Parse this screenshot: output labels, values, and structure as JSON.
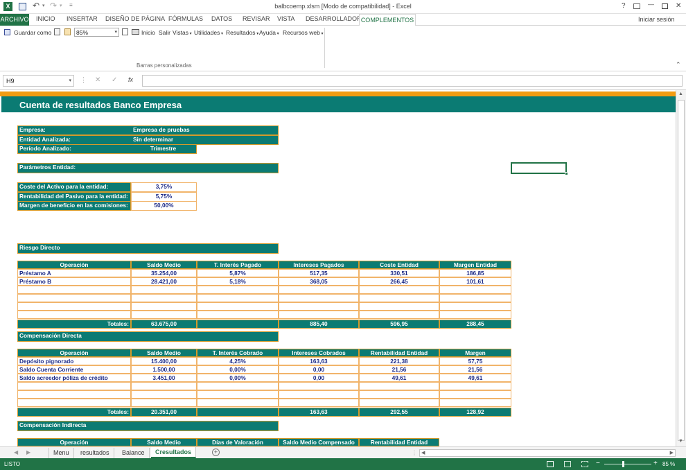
{
  "window": {
    "title": "balbcoemp.xlsm  [Modo de compatibilidad] - Excel",
    "help": "?",
    "minimize": "—",
    "close": "✕"
  },
  "menu": {
    "file": "ARCHIVO",
    "tabs": [
      "INICIO",
      "INSERTAR",
      "DISEÑO DE PÁGINA",
      "FÓRMULAS",
      "DATOS",
      "REVISAR",
      "VISTA",
      "DESARROLLADOR",
      "COMPLEMENTOS"
    ],
    "signin": "Iniciar sesión"
  },
  "ribbon": {
    "save_as": "Guardar como",
    "zoom": "85%",
    "items": [
      "Inicio",
      "Salir",
      "Vistas",
      "Utilidades",
      "Resultados",
      "Ayuda",
      "Recursos web"
    ],
    "group_label": "Barras personalizadas"
  },
  "formula_bar": {
    "name_box": "H9",
    "fx": "fx",
    "value": ""
  },
  "sheet": {
    "title": "Cuenta de resultados Banco Empresa",
    "info": [
      {
        "label": "Empresa:",
        "value": "Empresa de pruebas"
      },
      {
        "label": "Entidad Analizada:",
        "value": "Sin determinar"
      },
      {
        "label": "Período Analizado:",
        "value": "Trimestre"
      }
    ],
    "params_title": "Parámetros Entidad:",
    "params": [
      {
        "label": "Coste del Activo para la entidad:",
        "value": "3,75%"
      },
      {
        "label": "Rentabilidad del Pasivo para la entidad:",
        "value": "5,75%"
      },
      {
        "label": "Margen de beneficio en las comisiones:",
        "value": "50,00%"
      }
    ],
    "riesgo": {
      "title": "Riesgo Directo",
      "headers": [
        "Operación",
        "Saldo Medio",
        "T. Interés Pagado",
        "Intereses Pagados",
        "Coste Entidad",
        "Margen Entidad"
      ],
      "rows": [
        [
          "Préstamo A",
          "35.254,00",
          "5,87%",
          "517,35",
          "330,51",
          "186,85"
        ],
        [
          "Préstamo B",
          "28.421,00",
          "5,18%",
          "368,05",
          "266,45",
          "101,61"
        ]
      ],
      "totals": [
        "Totales:",
        "63.675,00",
        "",
        "885,40",
        "596,95",
        "288,45"
      ]
    },
    "compdir": {
      "title": "Compensación Directa",
      "headers": [
        "Operación",
        "Saldo Medio",
        "T. Interés Cobrado",
        "Intereses Cobrados",
        "Rentabilidad Entidad",
        "Margen"
      ],
      "rows": [
        [
          "Depósito pignorado",
          "15.400,00",
          "4,25%",
          "163,63",
          "221,38",
          "57,75"
        ],
        [
          "Saldo Cuenta Corriente",
          "1.500,00",
          "0,00%",
          "0,00",
          "21,56",
          "21,56"
        ],
        [
          "Saldo acreedor póliza de crédito",
          "3.451,00",
          "0,00%",
          "0,00",
          "49,61",
          "49,61"
        ]
      ],
      "totals": [
        "Totales:",
        "20.351,00",
        "",
        "163,63",
        "292,55",
        "128,92"
      ]
    },
    "compind": {
      "title": "Compensación Indirecta",
      "headers": [
        "Operación",
        "Saldo Medio",
        "Días de Valoración",
        "Saldo Medio Compensado",
        "Rentabilidad Entidad"
      ]
    }
  },
  "sheet_tabs": [
    "Menu",
    "resultados",
    "Balance",
    "Cresultados"
  ],
  "status": {
    "ready": "LISTO",
    "zoom": "85 %"
  },
  "colors": {
    "accent": "#217346",
    "teal": "#0b7b73",
    "orange": "#f39c12"
  }
}
